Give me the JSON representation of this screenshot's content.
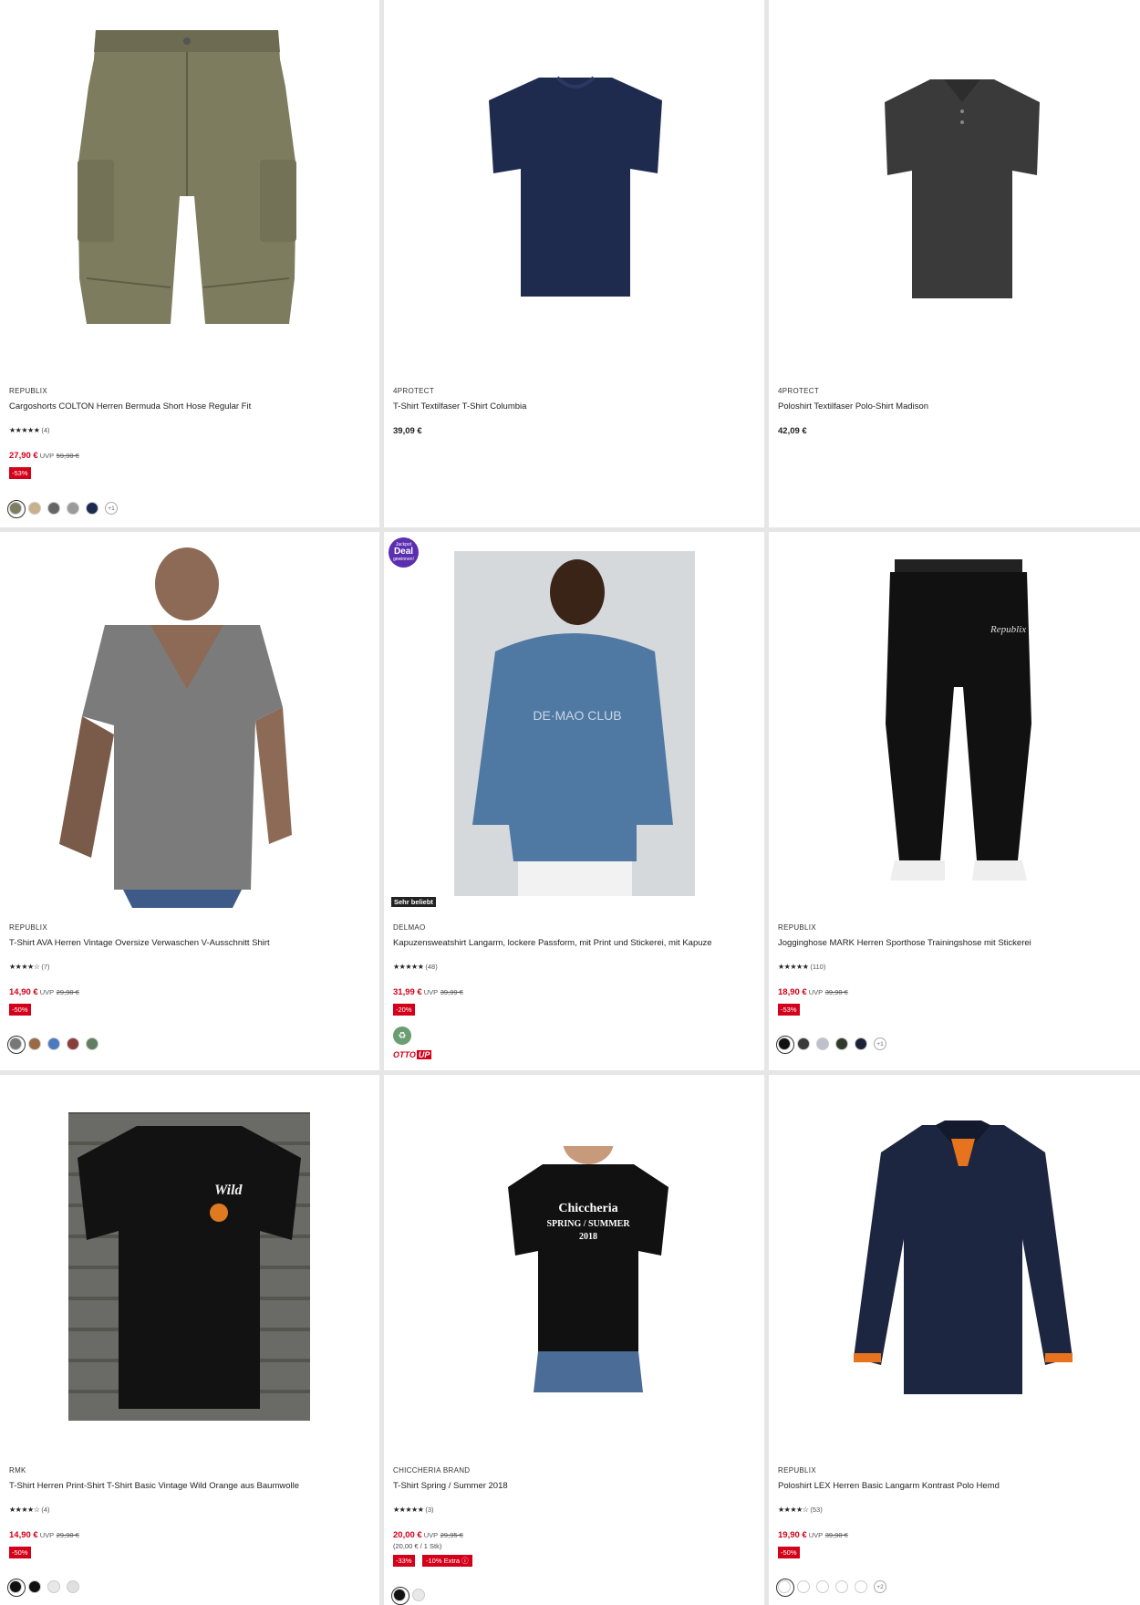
{
  "products": [
    {
      "brand": "REPUBLIX",
      "title": "Cargoshorts COLTON Herren Bermuda Short Hose Regular Fit",
      "stars": "★★★★★",
      "count": "(4)",
      "price": "27,90 €",
      "uvp": "UVP",
      "old": "59,90 €",
      "discount": "-53%",
      "swatches": [
        "#7c7f62",
        "#c8b08a",
        "#666",
        "#9a9a9a",
        "#1c2a52"
      ],
      "more": "+1"
    },
    {
      "brand": "4PROTECT",
      "title": "T-Shirt Textilfaser T-Shirt Columbia",
      "price": "39,09 €"
    },
    {
      "brand": "4PROTECT",
      "title": "Poloshirt Textilfaser Polo-Shirt Madison",
      "price": "42,09 €"
    },
    {
      "brand": "REPUBLIX",
      "title": "T-Shirt AVA Herren Vintage Oversize Verwaschen V-Ausschnitt Shirt",
      "stars": "★★★★☆",
      "count": "(7)",
      "price": "14,90 €",
      "uvp": "UVP",
      "old": "29,90 €",
      "discount": "-50%",
      "swatches": [
        "#777",
        "#9a6a45",
        "#4a7ac0",
        "#8b3d3d",
        "#5f7e62"
      ]
    },
    {
      "brand": "DELMAO",
      "title": "Kapuzensweatshirt Langarm, lockere Passform, mit Print und Stickerei, mit Kapuze",
      "stars": "★★★★★",
      "count": "(48)",
      "price": "31,99 €",
      "uvp": "UVP",
      "old": "39,99 €",
      "discount": "-20%",
      "tag": "Sehr beliebt",
      "jackpot_small": "Jackpot",
      "jackpot_big": "Deal",
      "jackpot_sub": "gewinnen!",
      "otto": "OTTO",
      "up": "UP"
    },
    {
      "brand": "REPUBLIX",
      "title": "Jogginghose MARK Herren Sporthose Trainingshose mit Stickerei",
      "stars": "★★★★★",
      "count": "(110)",
      "price": "18,90 €",
      "uvp": "UVP",
      "old": "39,90 €",
      "discount": "-53%",
      "swatches": [
        "#111",
        "#3a3a3a",
        "#c0c0cc",
        "#2f3a2a",
        "#1c2238"
      ],
      "more": "+1"
    },
    {
      "brand": "RMK",
      "title": "T-Shirt Herren Print-Shirt T-Shirt Basic Vintage Wild Orange aus Baumwolle",
      "stars": "★★★★☆",
      "count": "(4)",
      "price": "14,90 €",
      "uvp": "UVP",
      "old": "29,90 €",
      "discount": "-50%",
      "swatches": [
        "#111",
        "#111",
        "#e8e8e8",
        "#e0e0e0"
      ]
    },
    {
      "brand": "CHICCHERIA BRAND",
      "title": "T-Shirt Spring / Summer 2018",
      "stars": "★★★★★",
      "count": "(3)",
      "price": "20,00 €",
      "uvp": "UVP",
      "old": "29,95 €",
      "unit": "(20,00 € / 1 Stk)",
      "discount": "-33%",
      "extra": "-10% Extra ⓘ",
      "swatches": [
        "#111",
        "#e8e8e8"
      ]
    },
    {
      "brand": "REPUBLIX",
      "title": "Poloshirt LEX Herren Basic Langarm Kontrast Polo Hemd",
      "stars": "★★★★☆",
      "count": "(53)",
      "price": "19,90 €",
      "uvp": "UVP",
      "old": "39,90 €",
      "discount": "-50%",
      "swatches": [
        "#fff",
        "#fff",
        "#fff",
        "#fff",
        "#fff"
      ],
      "more": "+2"
    }
  ],
  "images": {
    "hoodie_text": "DE·MAO CLUB",
    "tee_print_line1": "Chiccheria",
    "tee_print_line2": "SPRING / SUMMER",
    "tee_print_line3": "2018",
    "jogger_brand": "Republix",
    "wild_print": "Wild"
  }
}
